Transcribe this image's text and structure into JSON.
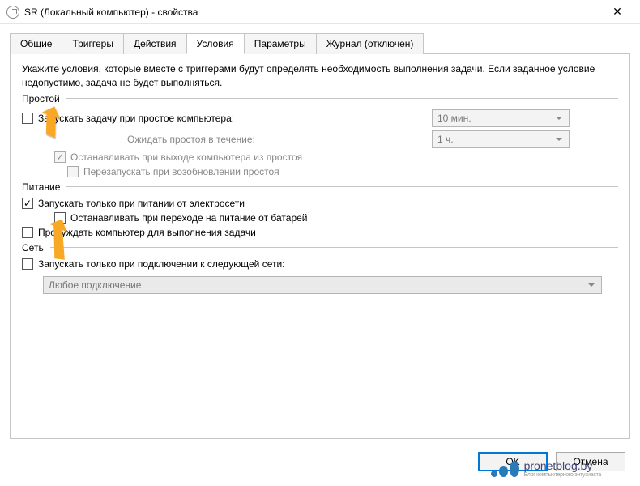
{
  "titlebar": {
    "title": "SR (Локальный компьютер) - свойства"
  },
  "tabs": {
    "items": [
      {
        "label": "Общие"
      },
      {
        "label": "Триггеры"
      },
      {
        "label": "Действия"
      },
      {
        "label": "Условия"
      },
      {
        "label": "Параметры"
      },
      {
        "label": "Журнал (отключен)"
      }
    ],
    "active_index": 3
  },
  "panel": {
    "description": "Укажите условия, которые вместе с триггерами будут определять необходимость выполнения задачи. Если заданное условие недопустимо, задача не будет выполняться.",
    "sections": {
      "idle": {
        "title": "Простой",
        "start_on_idle": {
          "label": "Запускать задачу при простое компьютера:",
          "checked": false
        },
        "wait_label": "Ожидать простоя в течение:",
        "idle_duration": "10 мин.",
        "wait_duration": "1 ч.",
        "stop_on_end_idle": {
          "label": "Останавливать при выходе компьютера из простоя",
          "checked": true,
          "disabled": true
        },
        "restart_on_idle": {
          "label": "Перезапускать при возобновлении простоя",
          "checked": false,
          "disabled": true
        }
      },
      "power": {
        "title": "Питание",
        "only_on_ac": {
          "label": "Запускать только при питании от электросети",
          "checked": true
        },
        "stop_on_battery": {
          "label": "Останавливать при переходе на питание от батарей",
          "checked": false
        },
        "wake_to_run": {
          "label": "Пробуждать компьютер для выполнения задачи",
          "checked": false
        }
      },
      "network": {
        "title": "Сеть",
        "only_on_network": {
          "label": "Запускать только при подключении к следующей сети:",
          "checked": false
        },
        "connection": "Любое подключение"
      }
    }
  },
  "buttons": {
    "ok": "OK",
    "cancel": "Отмена"
  },
  "watermark": {
    "text": "pronetblog.by",
    "subtext": "Блог компьютерного энтузиаста"
  }
}
